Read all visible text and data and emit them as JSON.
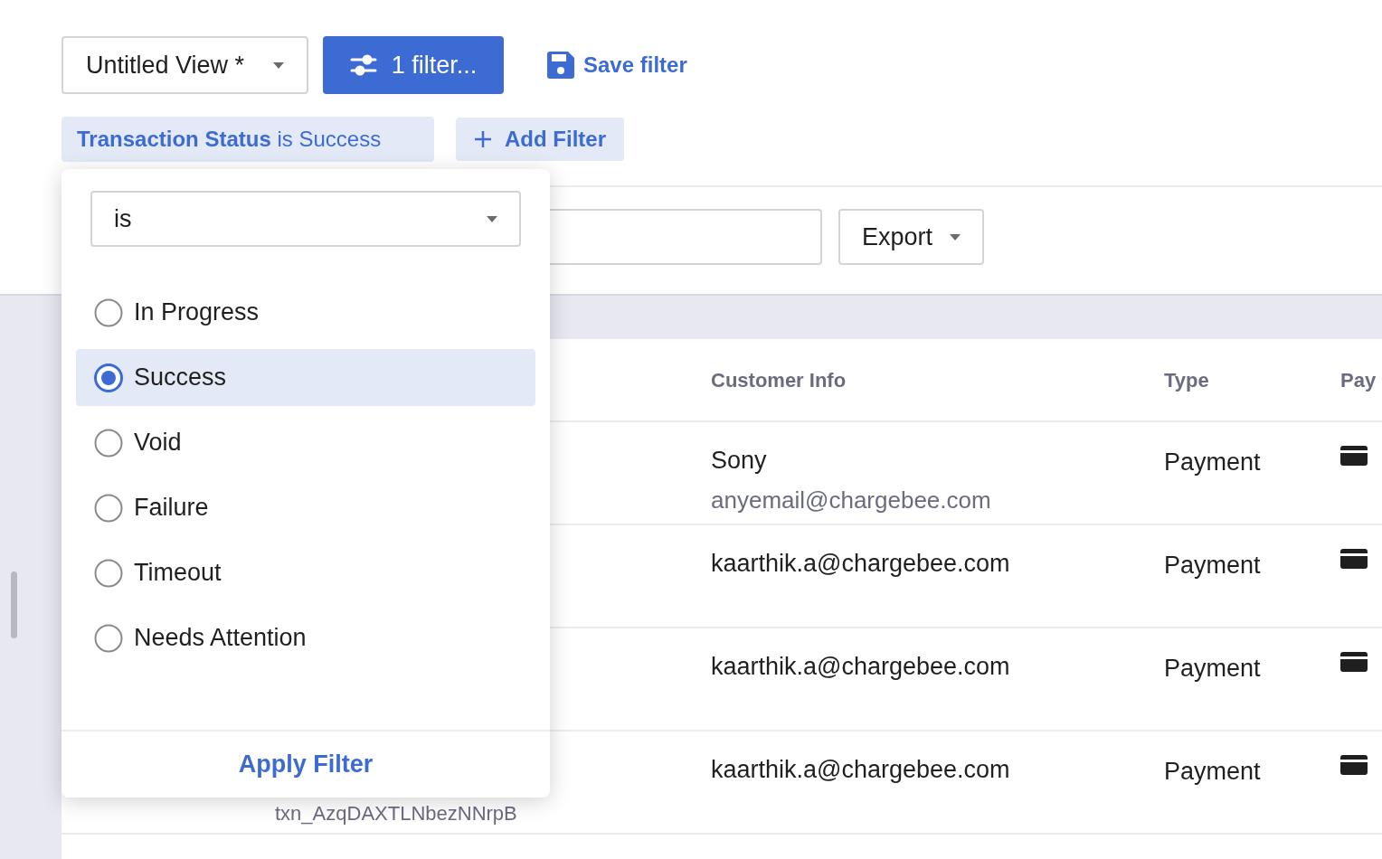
{
  "toolbar": {
    "view": "Untitled View *",
    "filter_button": "1 filter...",
    "save_filter": "Save filter"
  },
  "active_filter": {
    "field": "Transaction Status",
    "operator": "is",
    "value": "Success"
  },
  "add_filter": "Add Filter",
  "export": "Export",
  "table": {
    "columns": [
      "Customer Info",
      "Type",
      "Pay"
    ],
    "rows": [
      {
        "name": "Sony",
        "email": "anyemail@chargebee.com",
        "type": "Payment"
      },
      {
        "name": "kaarthik.a@chargebee.com",
        "type": "Payment"
      },
      {
        "name": "kaarthik.a@chargebee.com",
        "type": "Payment"
      },
      {
        "name": "kaarthik.a@chargebee.com",
        "type": "Payment"
      }
    ],
    "txn_id": "txn_AzqDAXTLNbezNNrpB"
  },
  "popover": {
    "operator": "is",
    "options": [
      {
        "label": "In Progress",
        "selected": false
      },
      {
        "label": "Success",
        "selected": true
      },
      {
        "label": "Void",
        "selected": false
      },
      {
        "label": "Failure",
        "selected": false
      },
      {
        "label": "Timeout",
        "selected": false
      },
      {
        "label": "Needs Attention",
        "selected": false
      }
    ],
    "apply": "Apply Filter"
  }
}
